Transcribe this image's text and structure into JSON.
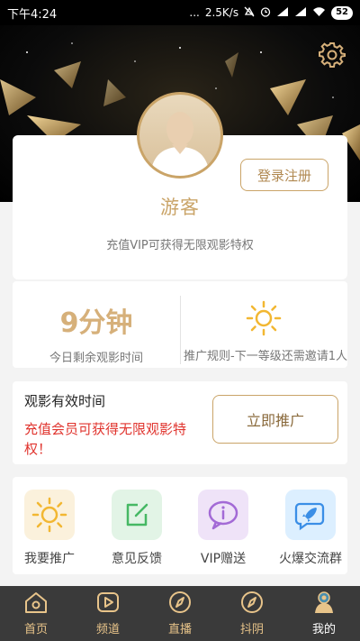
{
  "status_bar": {
    "time": "下午4:24",
    "dots": "...",
    "speed": "2.5K/s",
    "battery": "52"
  },
  "profile": {
    "login_label": "登录注册",
    "username": "游客",
    "vip_tip": "充值VIP可获得无限观影特权"
  },
  "stats": {
    "minutes": "9分钟",
    "minutes_label": "今日剩余观影时间",
    "promo_rule": "推广规则-下一等级还需邀请1人"
  },
  "validity": {
    "title": "观影有效时间",
    "tip": "充值会员可获得无限观影特权！",
    "promote_label": "立即推广"
  },
  "grid": [
    {
      "label": "我要推广",
      "icon": "sun-icon",
      "bg": "#fbf1dc"
    },
    {
      "label": "意见反馈",
      "icon": "feedback-icon",
      "bg": "#e2f4e6"
    },
    {
      "label": "VIP赠送",
      "icon": "info-bubble-icon",
      "bg": "#efe3f8"
    },
    {
      "label": "火爆交流群",
      "icon": "rocket-icon",
      "bg": "#dcefff"
    }
  ],
  "tabs": [
    {
      "label": "首页",
      "icon": "home-icon"
    },
    {
      "label": "频道",
      "icon": "play-icon"
    },
    {
      "label": "直播",
      "icon": "compass-icon"
    },
    {
      "label": "抖阴",
      "icon": "compass-icon"
    },
    {
      "label": "我的",
      "icon": "user-icon",
      "active": true
    }
  ],
  "colors": {
    "gold": "#caa468",
    "red": "#e0342e",
    "tabbar": "#3a3a3a"
  }
}
